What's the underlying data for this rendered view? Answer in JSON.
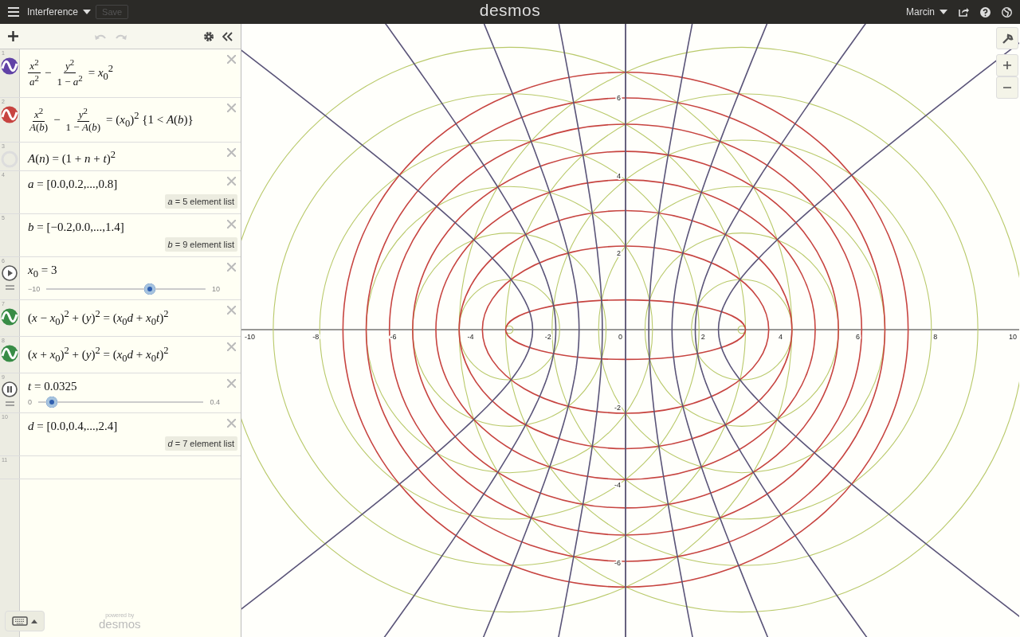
{
  "top_bar": {
    "title": "Interference",
    "save": {
      "label": "Save",
      "disabled": true
    },
    "logo": "desmos",
    "user": "Marcin"
  },
  "toolbar": {
    "undo_disabled": true,
    "redo_disabled": true
  },
  "expressions": [
    {
      "index": "1",
      "kind": "equation",
      "color": "#6042a6",
      "parts": [
        {
          "kind": "frac",
          "num": "*x*$^{2}$",
          "den": "*a*$^{2}$"
        },
        {
          "kind": "text",
          "text": "−"
        },
        {
          "kind": "frac",
          "num": "*y*$^{2}$",
          "den": "1 − *a*$^{2}$"
        },
        {
          "kind": "text",
          "text": "= *x*$_{0}$$^{2}$"
        }
      ]
    },
    {
      "index": "2",
      "kind": "equation",
      "color": "#c74440",
      "parts": [
        {
          "kind": "frac",
          "num": "*x*$^{2}$",
          "den": "*A*(*b*)"
        },
        {
          "kind": "text",
          "text": "−"
        },
        {
          "kind": "frac",
          "num": "*y*$^{2}$",
          "den": "1 − *A*(*b*)"
        },
        {
          "kind": "text",
          "text": "= (*x*$_{0}$)$^{2}$ {1 < *A*(*b*)}"
        }
      ]
    },
    {
      "index": "3",
      "kind": "definition",
      "parts": [
        {
          "kind": "text",
          "text": "*A*(*n*) = (1 + *n* + *t*)$^{2}$"
        }
      ]
    },
    {
      "index": "4",
      "kind": "list",
      "parts": [
        {
          "kind": "text",
          "text": "*a* = [0.0,0.2,...,0.8]"
        }
      ],
      "summary": "*a* = 5 element list"
    },
    {
      "index": "5",
      "kind": "list",
      "parts": [
        {
          "kind": "text",
          "text": "*b* = [−0.2,0.0,...,1.4]"
        }
      ],
      "summary": "*b* = 9 element list"
    },
    {
      "index": "6",
      "kind": "slider",
      "playing": false,
      "parts": [
        {
          "kind": "text",
          "text": "*x*$_{0}$ = 3"
        }
      ],
      "min": "−10",
      "max": "10",
      "level": 0.65
    },
    {
      "index": "7",
      "kind": "equation",
      "color": "#388c46",
      "parts": [
        {
          "kind": "text",
          "text": "(*x* − *x*$_{0}$)$^{2}$ + (*y*)$^{2}$ = (*x*$_{0}$*d* + *x*$_{0}$*t*)$^{2}$"
        }
      ]
    },
    {
      "index": "8",
      "kind": "equation",
      "color": "#388c46",
      "parts": [
        {
          "kind": "text",
          "text": "(*x* + *x*$_{0}$)$^{2}$ + (*y*)$^{2}$ = (*x*$_{0}$*d* + *x*$_{0}$*t*)$^{2}$"
        }
      ]
    },
    {
      "index": "9",
      "kind": "slider",
      "playing": true,
      "parts": [
        {
          "kind": "text",
          "text": "*t* = 0.0325"
        }
      ],
      "min": "0",
      "max": "0.4",
      "level": 0.081
    },
    {
      "index": "10",
      "kind": "list",
      "parts": [
        {
          "kind": "text",
          "text": "*d* = [0.0,0.4,...,2.4]"
        }
      ],
      "summary": "*d* = 7 element list"
    },
    {
      "index": "11",
      "kind": "empty"
    }
  ],
  "graph": {
    "x_ticks": [
      "-10",
      "-8",
      "-6",
      "-4",
      "-2",
      "2",
      "4",
      "6",
      "8",
      "10"
    ],
    "y_ticks": [
      "6",
      "4",
      "2",
      "-2",
      "-4",
      "-6"
    ],
    "origin": "0"
  },
  "footer": {
    "powered_by": "powered by",
    "logo": "desmos"
  }
}
